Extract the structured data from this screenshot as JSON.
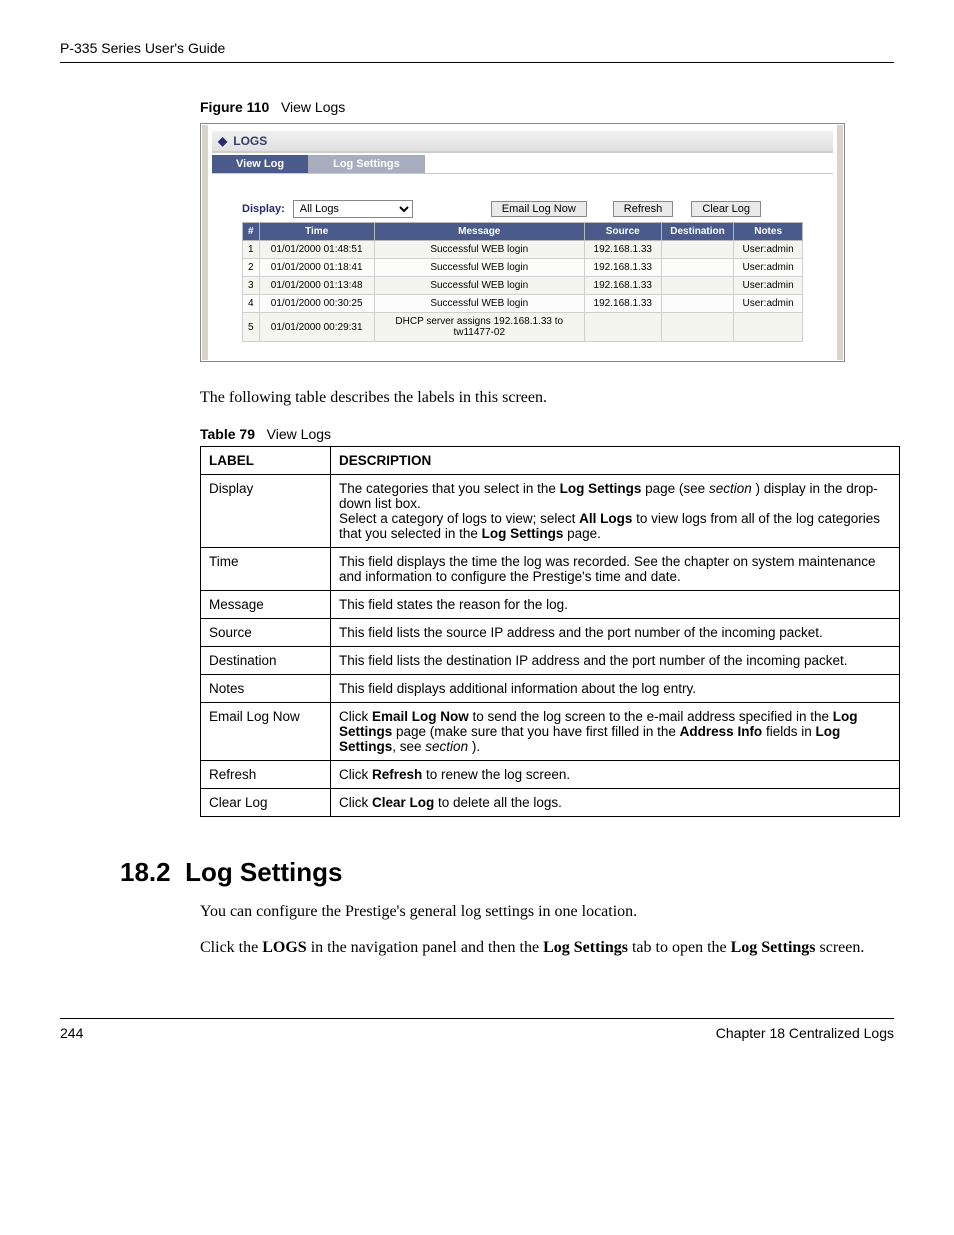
{
  "running_head": "P-335 Series User's Guide",
  "figure": {
    "label": "Figure 110",
    "title": "View Logs"
  },
  "shot": {
    "panel_title": "LOGS",
    "tabs": [
      {
        "label": "View Log",
        "active": true
      },
      {
        "label": "Log Settings",
        "active": false
      }
    ],
    "display_label": "Display:",
    "display_value": "All Logs",
    "buttons": {
      "email": "Email Log Now",
      "refresh": "Refresh",
      "clear": "Clear Log"
    },
    "columns": [
      "#",
      "Time",
      "Message",
      "Source",
      "Destination",
      "Notes"
    ],
    "rows": [
      {
        "n": "1",
        "time": "01/01/2000 01:48:51",
        "msg": "Successful WEB login",
        "src": "192.168.1.33",
        "dest": "",
        "notes": "User:admin"
      },
      {
        "n": "2",
        "time": "01/01/2000 01:18:41",
        "msg": "Successful WEB login",
        "src": "192.168.1.33",
        "dest": "",
        "notes": "User:admin"
      },
      {
        "n": "3",
        "time": "01/01/2000 01:13:48",
        "msg": "Successful WEB login",
        "src": "192.168.1.33",
        "dest": "",
        "notes": "User:admin"
      },
      {
        "n": "4",
        "time": "01/01/2000 00:30:25",
        "msg": "Successful WEB login",
        "src": "192.168.1.33",
        "dest": "",
        "notes": "User:admin"
      },
      {
        "n": "5",
        "time": "01/01/2000 00:29:31",
        "msg": "DHCP server assigns 192.168.1.33 to tw11477-02",
        "src": "",
        "dest": "",
        "notes": ""
      }
    ]
  },
  "para_after_figure": "The following table describes the labels in this screen.",
  "table_caption": {
    "label": "Table 79",
    "title": "View Logs"
  },
  "desc_table": {
    "headers": [
      "LABEL",
      "DESCRIPTION"
    ],
    "rows": [
      {
        "label": "Display",
        "plain": "",
        "html": "The categories that you select in the <b>Log Settings</b> page (see <i>section</i> ) display in the drop-down list box.<br>Select a category of logs to view; select <b>All Logs</b> to view logs from all of the log categories that you selected in the <b>Log Settings</b> page."
      },
      {
        "label": "Time",
        "html": "This field displays the time the log was recorded. See the chapter on system maintenance and information to configure the Prestige's time and date."
      },
      {
        "label": "Message",
        "html": "This field states the reason for the log."
      },
      {
        "label": "Source",
        "html": "This field lists the source IP address and the port number of the incoming packet."
      },
      {
        "label": "Destination",
        "html": "This field lists the destination IP address and the port number of the incoming packet."
      },
      {
        "label": "Notes",
        "html": "This field displays additional information about the log entry."
      },
      {
        "label": "Email Log Now",
        "html": "Click <b>Email Log Now</b> to send the log screen to the e-mail address specified in the <b>Log Settings</b> page (make sure that you have first filled in the <b>Address Info</b> fields in <b>Log Settings</b>, see <i>section</i> )."
      },
      {
        "label": "Refresh",
        "html": "Click <b>Refresh</b> to renew the log screen."
      },
      {
        "label": "Clear Log",
        "html": "Click <b>Clear Log</b> to delete all the logs."
      }
    ]
  },
  "section": {
    "number": "18.2",
    "title": "Log Settings",
    "para1": "You can configure the Prestige's general log settings in one location.",
    "para2_html": "Click the <b>LOGS</b> in the navigation panel and then the <b>Log Settings</b> tab to open the <b>Log Settings</b> screen."
  },
  "footer": {
    "page": "244",
    "chapter": "Chapter 18 Centralized Logs"
  }
}
